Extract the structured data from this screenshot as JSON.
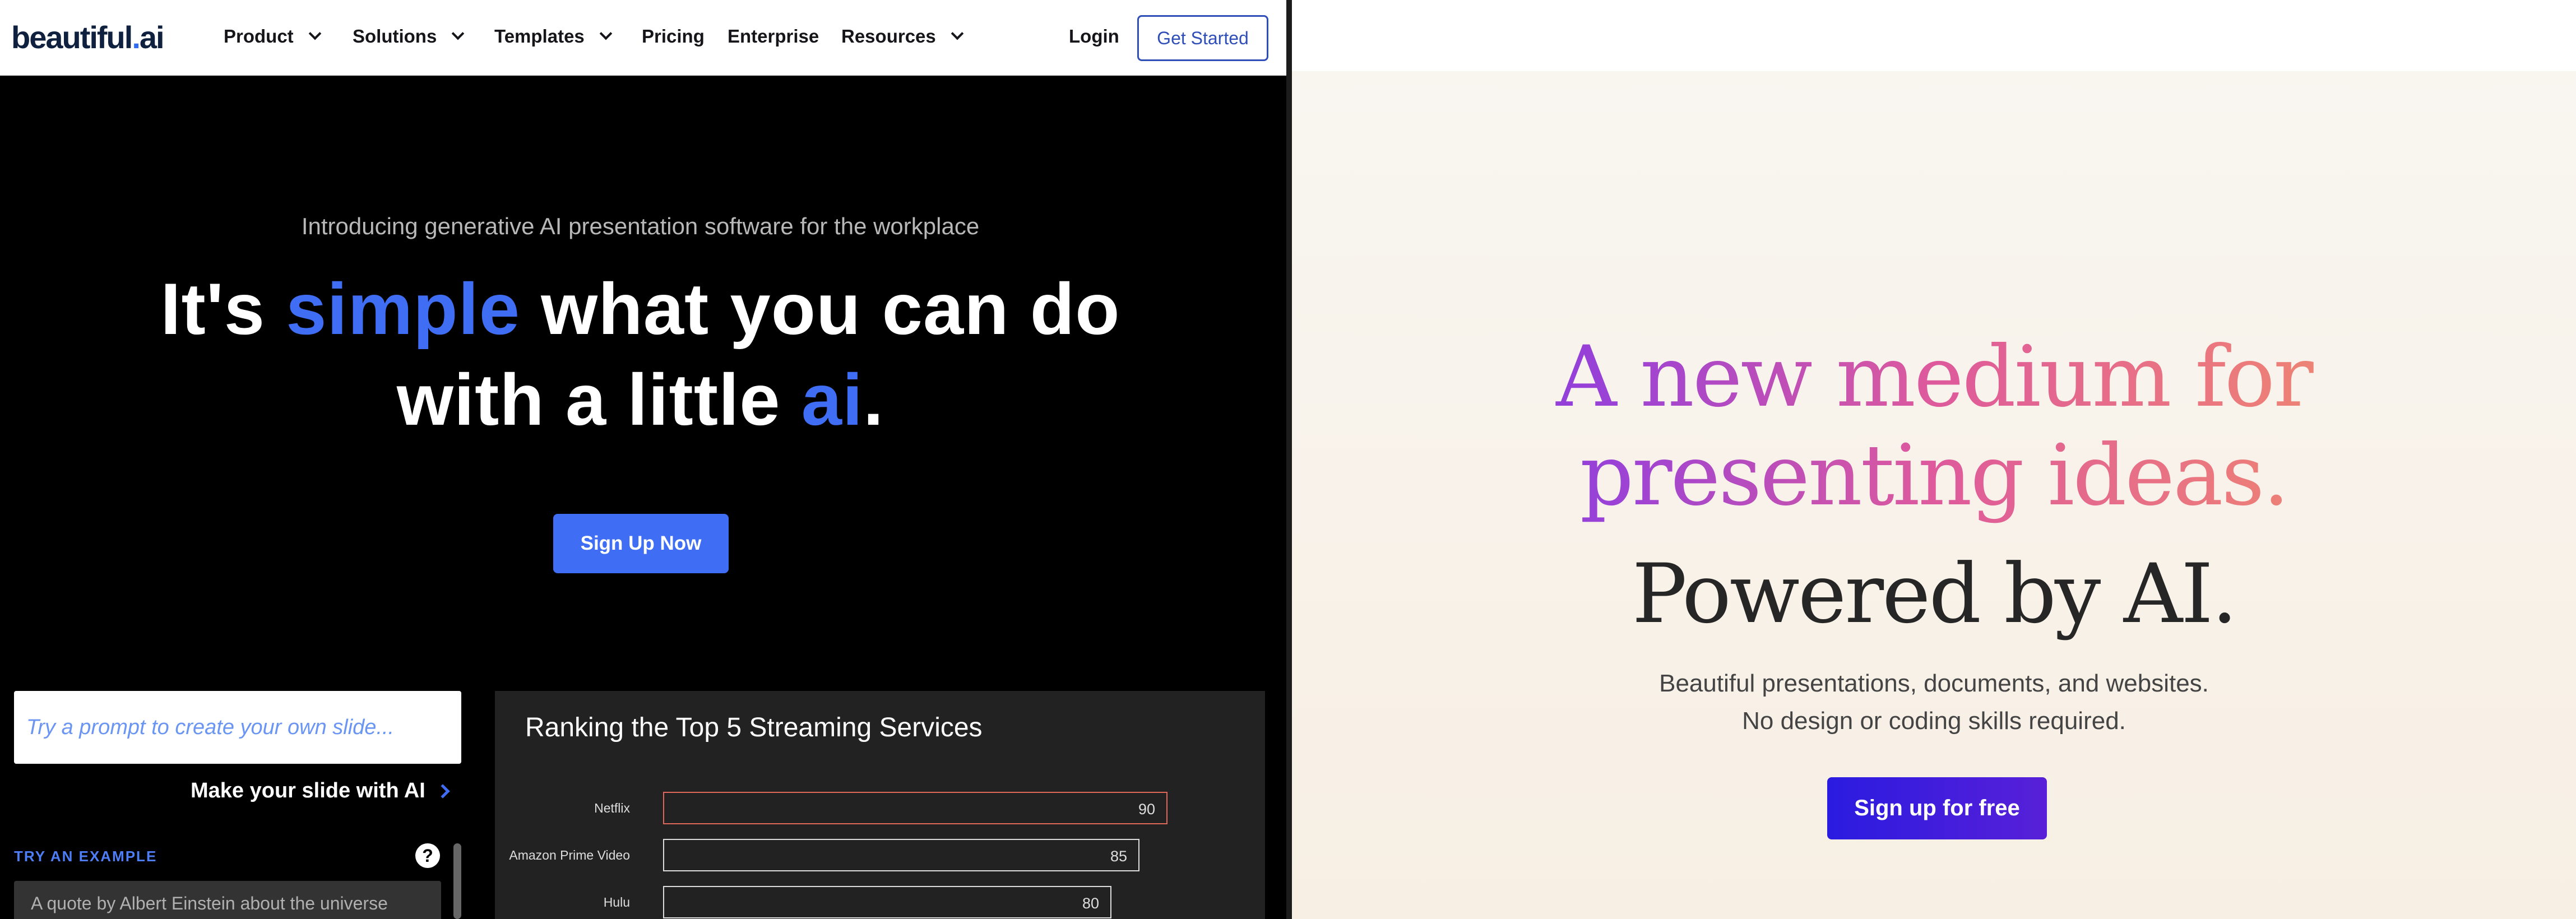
{
  "left": {
    "nav": {
      "logo_main": "beautiful",
      "logo_dot": ".",
      "logo_suffix": "ai",
      "items": [
        {
          "label": "Product",
          "has_dropdown": true
        },
        {
          "label": "Solutions",
          "has_dropdown": true
        },
        {
          "label": "Templates",
          "has_dropdown": true
        },
        {
          "label": "Pricing",
          "has_dropdown": false
        },
        {
          "label": "Enterprise",
          "has_dropdown": false
        },
        {
          "label": "Resources",
          "has_dropdown": true
        }
      ],
      "login": "Login",
      "get_started": "Get Started"
    },
    "hero": {
      "intro": "Introducing generative AI presentation software for the workplace",
      "h1_part1": "It's ",
      "h1_highlight1": "simple",
      "h1_part2": " what you can do",
      "h1_part3": "with a little ",
      "h1_highlight2": "ai",
      "h1_part4": ".",
      "cta": "Sign Up Now"
    },
    "prompt": {
      "placeholder": "Try a prompt to create your own slide...",
      "make_slide": "Make your slide with AI",
      "try_example": "TRY AN EXAMPLE",
      "help": "?",
      "example_1": "A quote by Albert Einstein about the universe"
    },
    "slide": {
      "title": "Ranking the Top 5 Streaming Services"
    },
    "chart_data": {
      "type": "bar",
      "title": "Ranking the Top 5 Streaming Services",
      "categories": [
        "Netflix",
        "Amazon Prime Video",
        "Hulu"
      ],
      "values": [
        90,
        85,
        80
      ],
      "xlabel": "",
      "ylabel": "",
      "xlim": [
        0,
        100
      ],
      "orientation": "horizontal"
    },
    "colors": {
      "accent_blue": "#3f6ef4",
      "top_bar_border": "#e0675b"
    }
  },
  "right": {
    "headline_line1": "A new medium for",
    "headline_line2": "presenting ideas.",
    "powered": "Powered by AI.",
    "sub1": "Beautiful presentations, documents, and websites.",
    "sub2": "No design or coding skills required.",
    "cta": "Sign up for free",
    "colors": {
      "gradient_start": "#6a32e6",
      "gradient_mid": "#de5a9c",
      "gradient_end": "#eea35f",
      "cta_bg": "#2a1be0"
    }
  }
}
